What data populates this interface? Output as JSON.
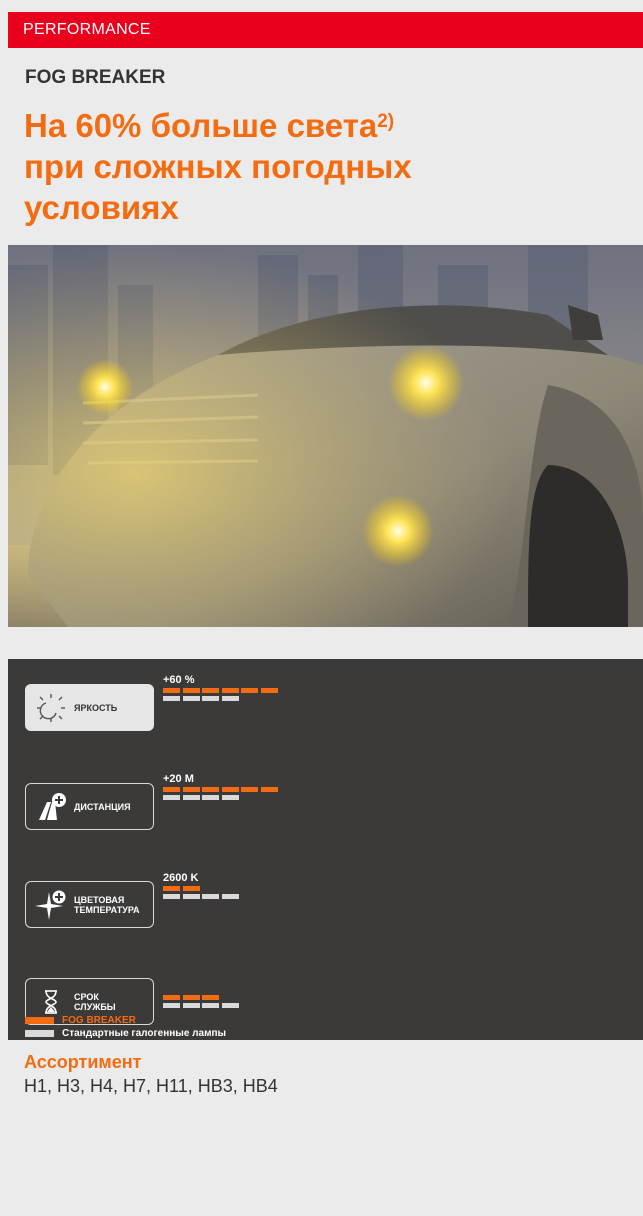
{
  "header": {
    "category": "PERFORMANCE"
  },
  "product": {
    "name": "FOG BREAKER",
    "headline_line1": "На 60% больше света",
    "headline_sup": "2)",
    "headline_line2": "при сложных погодных",
    "headline_line3": "условиях"
  },
  "photo": {
    "subject": "car-with-yellow-headlights-in-fog"
  },
  "features": [
    {
      "icon": "sun-icon",
      "label": "ЯРКОСТЬ",
      "value": "+60 %",
      "product_bars": 6,
      "standard_bars": 4
    },
    {
      "icon": "road-plus-icon",
      "label": "ДИСТАНЦИЯ",
      "value": "+20 M",
      "product_bars": 6,
      "standard_bars": 4
    },
    {
      "icon": "light-plus-icon",
      "label": "ЦВЕТОВАЯ ТЕМПЕРАТУРА",
      "label_line1": "ЦВЕТОВАЯ",
      "label_line2": "ТЕМПЕРАТУРА",
      "value": "2600 K",
      "product_bars": 2,
      "standard_bars": 4
    },
    {
      "icon": "hourglass-icon",
      "label": "СРОК СЛУЖБЫ",
      "label_line1": "СРОК",
      "label_line2": "СЛУЖБЫ",
      "value": "",
      "product_bars": 3,
      "standard_bars": 4
    }
  ],
  "legend": {
    "product": "FOG BREAKER",
    "standard": "Стандартные галогенные лампы"
  },
  "assortment": {
    "title": "Ассортимент",
    "list": "H1, H3, H4, H7, H11, HB3, HB4"
  },
  "colors": {
    "brand_red": "#e8001c",
    "accent_orange": "#f36c11",
    "panel": "#3b3a39",
    "bar_grey": "#d9d9d9"
  }
}
